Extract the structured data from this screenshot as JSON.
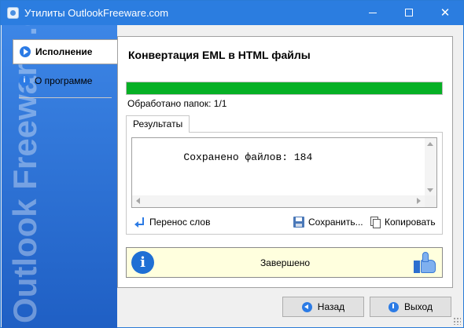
{
  "window": {
    "title": "Утилиты OutlookFreeware.com",
    "min_icon": "minimize-icon",
    "max_icon": "maximize-icon",
    "close_glyph": "✕"
  },
  "sidebar": {
    "watermark": "Outlook Freeware .com",
    "items": [
      {
        "label": "Исполнение",
        "icon": "play-icon",
        "active": true
      },
      {
        "label": "О программе",
        "icon": "info-icon",
        "active": false
      }
    ]
  },
  "main": {
    "heading": "Конвертация EML в HTML файлы",
    "progress": {
      "fraction": 1.0,
      "label": "Обработано папок: 1/1",
      "color": "#06b025"
    },
    "tabs": [
      {
        "label": "Результаты"
      }
    ],
    "results_text": "Сохранено файлов: 184",
    "toolbar": {
      "wrap_label": "Перенос слов",
      "save_label": "Сохранить...",
      "copy_label": "Копировать"
    },
    "status": {
      "info_glyph": "i",
      "message": "Завершено",
      "icon": "thumbs-up-icon",
      "background": "#ffffde"
    }
  },
  "footer": {
    "back_label": "Назад",
    "exit_label": "Выход"
  },
  "colors": {
    "titlebar": "#2b7de0",
    "sidebar": "#2a6fd1",
    "accent": "#2c7be5"
  }
}
